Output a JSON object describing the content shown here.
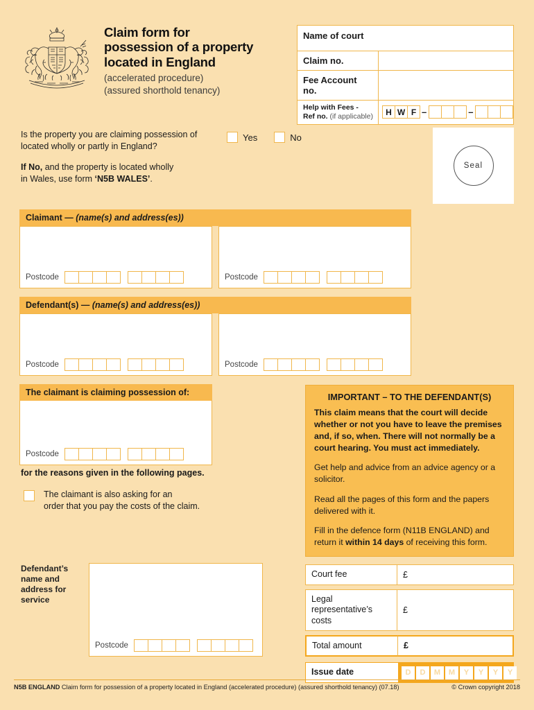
{
  "header": {
    "crest_icon": "royal-coat-of-arms",
    "title_lines": [
      "Claim form for",
      "possession of a property",
      "located in England"
    ],
    "subtitle_lines": [
      "(accelerated procedure)",
      "(assured shorthold tenancy)"
    ]
  },
  "court_table": {
    "name_of_court_label": "Name of court",
    "claim_no_label": "Claim no.",
    "claim_no_value": "",
    "fee_account_label": "Fee Account no.",
    "fee_account_value": "",
    "hwf_label_bold": "Help with Fees -",
    "hwf_label_bold2": "Ref no.",
    "hwf_label_light": "(if applicable)",
    "hwf_letters": [
      "H",
      "W",
      "F"
    ],
    "hwf_separator": "–",
    "hwf_group1_cells": 3,
    "hwf_group2_cells": 3
  },
  "question": {
    "line1": "Is the property you are claiming possession of",
    "line2": "located wholly or partly in England?",
    "note_bold": "If No,",
    "note_rest": " and the property is located wholly",
    "note_line2_pre": "in Wales, use form ",
    "note_line2_bold": "‘N5B WALES’",
    "note_line2_post": ".",
    "yes_label": "Yes",
    "no_label": "No"
  },
  "seal": {
    "label": "Seal"
  },
  "claimant": {
    "heading_bold": "Claimant",
    "heading_dash": " — ",
    "heading_italic": "(name(s) and address(es))",
    "postcode_label": "Postcode",
    "postcode_group1_cells": 4,
    "postcode_group2_cells": 4
  },
  "defendant": {
    "heading_bold": "Defendant(s)",
    "heading_dash": " — ",
    "heading_italic": "(name(s) and address(es))",
    "postcode_label": "Postcode",
    "postcode_group1_cells": 4,
    "postcode_group2_cells": 4
  },
  "possession": {
    "heading": "The claimant is claiming possession of:",
    "postcode_label": "Postcode",
    "reasons_line": "for the reasons given in the following pages.",
    "costs_line1": "The claimant is also asking for an",
    "costs_line2": "order that you pay the costs of the claim."
  },
  "important": {
    "title": "IMPORTANT – TO THE DEFENDANT(S)",
    "bold_paragraph": "This claim means that the court will decide whether or not you have to leave the premises and, if so, when. There will not normally be a court hearing. You must act immediately.",
    "p1": "Get help and advice from an advice agency or a solicitor.",
    "p2": "Read all the pages of this form and the papers delivered with it.",
    "p3_pre": "Fill in the defence form (N11B ENGLAND) and return it ",
    "p3_bold": "within 14 days",
    "p3_post": " of receiving this form."
  },
  "service": {
    "label": "Defendant’s name and address for service",
    "postcode_label": "Postcode",
    "postcode_group1_cells": 4,
    "postcode_group2_cells": 4
  },
  "fees": {
    "rows": [
      {
        "label": "Court fee",
        "value": "£"
      },
      {
        "label": "Legal representative’s costs",
        "value": "£"
      },
      {
        "label": "Total amount",
        "value": "£"
      }
    ],
    "issue_date_label": "Issue date",
    "issue_date_cells": [
      "D",
      "D",
      "M",
      "M",
      "Y",
      "Y",
      "Y",
      "Y"
    ]
  },
  "footer": {
    "code": "N5B ENGLAND",
    "description": " Claim form for possession of a property located in England (accelerated procedure) (assured shorthold tenancy) (07.18)",
    "copyright": "© Crown copyright 2018"
  },
  "colors": {
    "page_background": "#FAE0B0",
    "panel_header": "#F8B94F",
    "accent_border": "#F0B64A",
    "important_background": "#F9BE52",
    "issue_date_background": "#F4A71D",
    "field_background": "#FFFFFF"
  }
}
